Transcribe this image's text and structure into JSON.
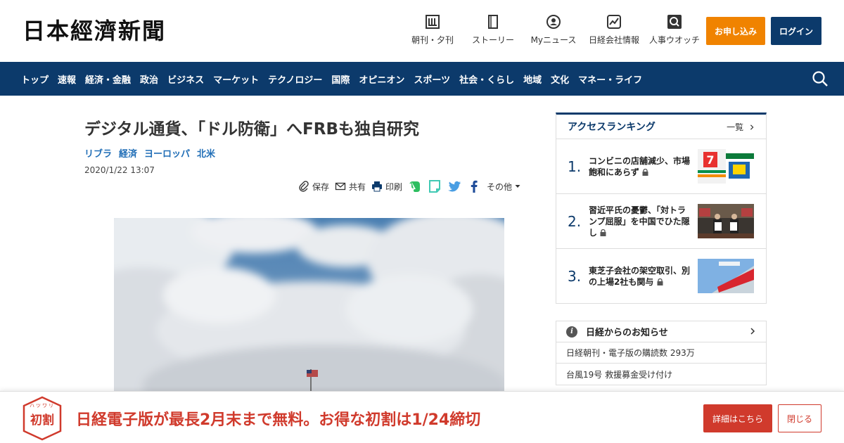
{
  "header": {
    "logo": "日本經濟新聞",
    "nav": [
      {
        "label": "朝刊・夕刊",
        "icon": "newspaper-icon"
      },
      {
        "label": "ストーリー",
        "icon": "book-icon"
      },
      {
        "label": "Myニュース",
        "icon": "user-icon"
      },
      {
        "label": "日経会社情報",
        "icon": "chart-icon"
      },
      {
        "label": "人事ウオッチ",
        "icon": "search-person-icon"
      }
    ],
    "apply_label": "お申し込み",
    "login_label": "ログイン",
    "apply_color": "#f08300",
    "brand_color": "#0c3a6b"
  },
  "mainnav": {
    "items": [
      "トップ",
      "速報",
      "経済・金融",
      "政治",
      "ビジネス",
      "マーケット",
      "テクノロジー",
      "国際",
      "オピニオン",
      "スポーツ",
      "社会・くらし",
      "地域",
      "文化",
      "マネー・ライフ"
    ],
    "search_icon": "search-icon"
  },
  "article": {
    "title": "デジタル通貨、「ドル防衛」へFRBも独自研究",
    "tags": [
      "リブラ",
      "経済",
      "ヨーロッパ",
      "北米"
    ],
    "date": "2020/1/22 13:07",
    "tools": {
      "save": "保存",
      "share": "共有",
      "print": "印刷",
      "more": "その他"
    }
  },
  "ranking": {
    "title": "アクセスランキング",
    "more": "一覧",
    "items": [
      {
        "num": "1.",
        "text": "コンビニの店舗減少、市場飽和にあらず"
      },
      {
        "num": "2.",
        "text": "習近平氏の憂鬱、「対トランプ屈服」を中国でひた隠し"
      },
      {
        "num": "3.",
        "text": "東芝子会社の架空取引、別の上場2社も関与"
      }
    ]
  },
  "notice": {
    "title": "日経からのお知らせ",
    "items": [
      "日経朝刊・電子版の購読数 293万",
      "台風19号 救援募金受け付け"
    ]
  },
  "promo": {
    "badge_kana": "ハツワリ",
    "badge_text": "初割",
    "text": "日経電子版が最長2月末まで無料。お得な初割は1/24締切",
    "detail_label": "詳細はこちら",
    "close_label": "閉じる",
    "color": "#d03a2c"
  }
}
